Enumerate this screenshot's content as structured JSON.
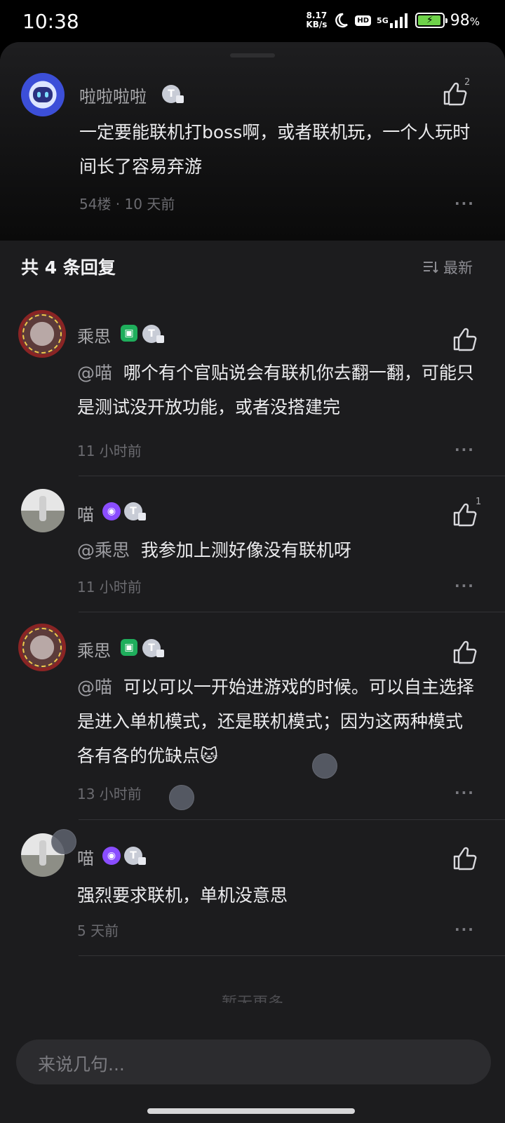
{
  "status_bar": {
    "time": "10:38",
    "net_speed_value": "8.17",
    "net_speed_unit": "KB/s",
    "moon_icon": "moon-icon",
    "hd": "HD",
    "network": "5G",
    "battery": "98",
    "battery_unit": "%"
  },
  "main_comment": {
    "user": "啦啦啦啦",
    "badge": "T",
    "text": "一定要能联机打boss啊，或者联机玩，一个人玩时间长了容易弃游",
    "meta": "54楼 · 10 天前",
    "likes": "2",
    "more": "···"
  },
  "replies_header": {
    "title": "共 4 条回复",
    "sort_label": "最新"
  },
  "replies": [
    {
      "user": "乘思",
      "badge": "T",
      "mention": "@喵",
      "text": "哪个有个官贴说会有联机你去翻一翻，可能只是测试没开放功能，或者没搭建完",
      "time": "11 小时前",
      "likes": "",
      "more": "···"
    },
    {
      "user": "喵",
      "badge": "T",
      "mention": "@乘思",
      "text": "我参加上测好像没有联机呀",
      "time": "11 小时前",
      "likes": "1",
      "more": "···"
    },
    {
      "user": "乘思",
      "badge": "T",
      "mention": "@喵",
      "text": "可以可以一开始进游戏的时候。可以自主选择是进入单机模式，还是联机模式；因为这两种模式各有各的优缺点",
      "emoji": "🐱",
      "time": "13 小时前",
      "likes": "",
      "more": "···"
    },
    {
      "user": "喵",
      "badge": "T",
      "mention": "",
      "text": "强烈要求联机，单机没意思",
      "time": "5 天前",
      "likes": "",
      "more": "···"
    }
  ],
  "footer": {
    "no_more": "暂无更多",
    "input_placeholder": "来说几句..."
  },
  "colors": {
    "background": "#1c1c1e",
    "badge_green": "#1fae5c",
    "badge_purple": "#8a4dff"
  }
}
